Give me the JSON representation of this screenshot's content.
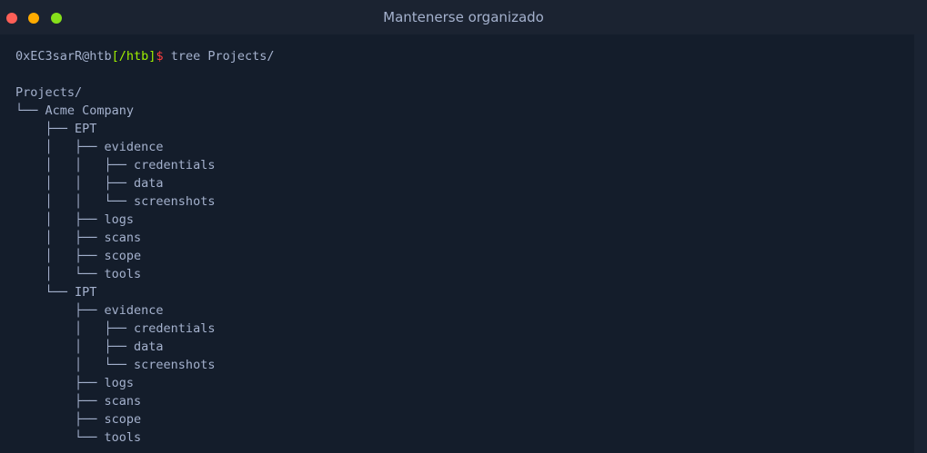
{
  "window": {
    "title": "Mantenerse organizado",
    "colors": {
      "close": "#ff5f57",
      "minimize": "#ffab00",
      "maximize": "#86e01a"
    }
  },
  "prompt": {
    "user": "0xEC3sarR@htb",
    "path": "[/htb]",
    "symbol": "$",
    "command": " tree Projects/"
  },
  "output": [
    "",
    "Projects/",
    "└── Acme Company",
    "    ├── EPT",
    "    │   ├── evidence",
    "    │   │   ├── credentials",
    "    │   │   ├── data",
    "    │   │   └── screenshots",
    "    │   ├── logs",
    "    │   ├── scans",
    "    │   ├── scope",
    "    │   └── tools",
    "    └── IPT",
    "        ├── evidence",
    "        │   ├── credentials",
    "        │   ├── data",
    "        │   └── screenshots",
    "        ├── logs",
    "        ├── scans",
    "        ├── scope",
    "        └── tools"
  ]
}
